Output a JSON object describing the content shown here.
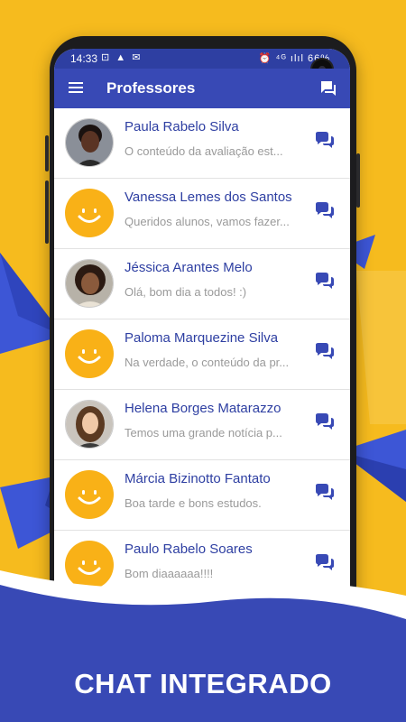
{
  "status_bar": {
    "time": "14:33",
    "left_icons": "⊡ ▲ ✉",
    "right_icons": "⏰ ⁴ᴳ ılıl 66%"
  },
  "app_bar": {
    "title": "Professores",
    "menu_icon": "hamburger-menu-icon",
    "action_icon": "chat-bubbles-icon"
  },
  "contacts": [
    {
      "name": "Paula Rabelo Silva",
      "message": "O conteúdo da avaliação est...",
      "avatar": "photo-dark"
    },
    {
      "name": "Vanessa Lemes dos Santos",
      "message": "Queridos alunos, vamos fazer...",
      "avatar": "smiley"
    },
    {
      "name": "Jéssica Arantes Melo",
      "message": "Olá, bom dia a todos! :)",
      "avatar": "photo-curly"
    },
    {
      "name": "Paloma Marquezine Silva",
      "message": "Na verdade, o conteúdo da pr...",
      "avatar": "smiley"
    },
    {
      "name": "Helena Borges Matarazzo",
      "message": "Temos uma grande notícia p...",
      "avatar": "photo-light"
    },
    {
      "name": "Márcia Bizinotto Fantato",
      "message": "Boa tarde e bons estudos.",
      "avatar": "smiley"
    },
    {
      "name": "Paulo Rabelo Soares",
      "message": "Bom diaaaaaa!!!!",
      "avatar": "smiley"
    }
  ],
  "caption": "CHAT INTEGRADO",
  "colors": {
    "background": "#F6BB1E",
    "primary": "#3849B5",
    "accent_blue": "#3D56D6",
    "smiley": "#F9B117"
  }
}
